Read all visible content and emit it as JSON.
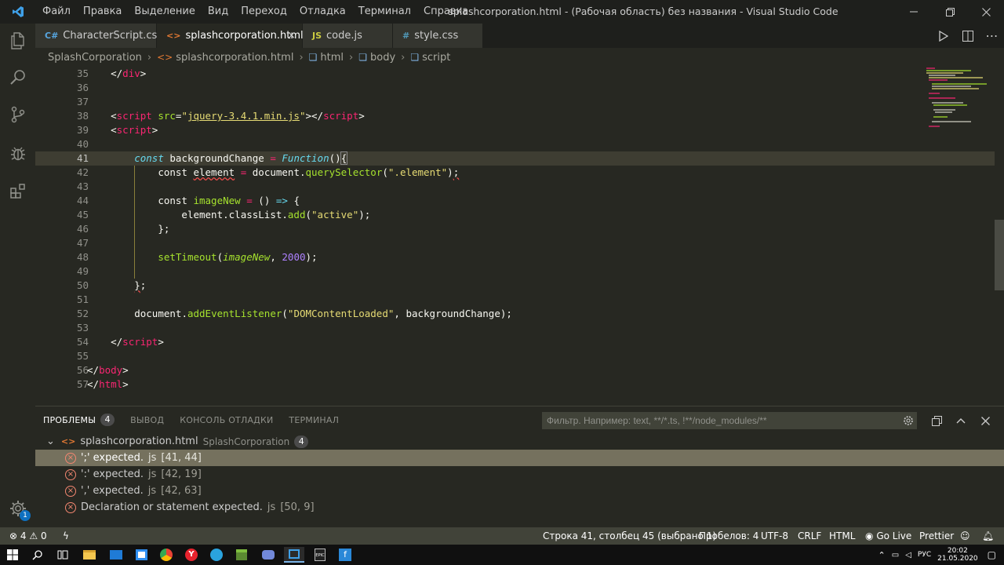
{
  "titlebar": {
    "menu": [
      "Файл",
      "Правка",
      "Выделение",
      "Вид",
      "Переход",
      "Отладка",
      "Терминал",
      "Справка"
    ],
    "title": "splashcorporation.html - (Рабочая область) без названия - Visual Studio Code"
  },
  "tabs": [
    {
      "label": "CharacterScript.cs",
      "icon": "csharp-icon",
      "active": false
    },
    {
      "label": "splashcorporation.html",
      "icon": "html-icon",
      "active": true,
      "close": "×"
    },
    {
      "label": "code.js",
      "icon": "js-icon",
      "icon_text": "JS",
      "active": false
    },
    {
      "label": "style.css",
      "icon": "css-icon",
      "icon_text": "#",
      "active": false
    }
  ],
  "breadcrumb": [
    "SplashCorporation",
    "splashcorporation.html",
    "html",
    "body",
    "script"
  ],
  "editor": {
    "line_numbers": [
      "35",
      "36",
      "37",
      "38",
      "39",
      "40",
      "41",
      "42",
      "43",
      "44",
      "45",
      "46",
      "47",
      "48",
      "49",
      "50",
      "51",
      "52",
      "53",
      "54",
      "55",
      "56",
      "57"
    ],
    "current_line": "41"
  },
  "panel": {
    "tabs": [
      "ПРОБЛЕМЫ",
      "ВЫВОД",
      "КОНСОЛЬ ОТЛАДКИ",
      "ТЕРМИНАЛ"
    ],
    "problem_count": "4",
    "filter_placeholder": "Фильтр. Например: text, **/*.ts, !**/node_modules/**",
    "file": {
      "name": "splashcorporation.html",
      "dir": "SplashCorporation",
      "count": "4"
    },
    "problems": [
      {
        "message": "';' expected.",
        "source": "js",
        "location": "[41, 44]"
      },
      {
        "message": "':' expected.",
        "source": "js",
        "location": "[42, 19]"
      },
      {
        "message": "',' expected.",
        "source": "js",
        "location": "[42, 63]"
      },
      {
        "message": "Declaration or statement expected.",
        "source": "js",
        "location": "[50, 9]"
      }
    ]
  },
  "statusbar": {
    "errors": "4",
    "warnings": "0",
    "position": "Строка 41, столбец 45 (выбрано 1)",
    "spaces": "Пробелов: 4",
    "encoding": "UTF-8",
    "eol": "CRLF",
    "language": "HTML",
    "golive": "Go Live",
    "prettier": "Prettier",
    "settings_badge": "1"
  },
  "taskbar": {
    "lang": "РУС",
    "time": "20:02",
    "date": "21.05.2020"
  },
  "colors": {
    "accent_error": "#f48771",
    "status_bg": "#414339",
    "editor_bg": "#272822"
  }
}
